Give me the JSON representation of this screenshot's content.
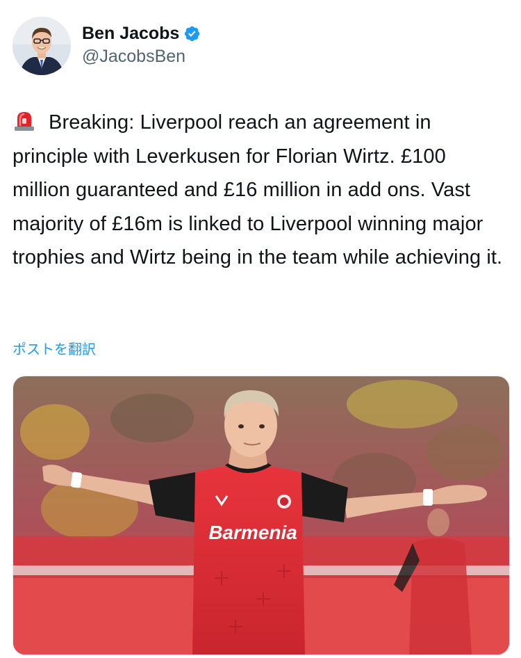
{
  "author": {
    "display_name": "Ben Jacobs",
    "handle": "@JacobsBen",
    "avatar_icon": "profile-photo-avatar",
    "verified_icon": "verified-badge-icon",
    "verified_color": "#1d9bf0"
  },
  "tweet": {
    "emoji_icon": "police-siren-icon",
    "text": "Breaking: Liverpool reach an agreement in principle with Leverkusen for Florian Wirtz. £100 million guaranteed and £16 million in add ons. Vast majority of £16m is linked to Liverpool winning major trophies and Wirtz being in the team while achieving it.",
    "translate_label": "ポストを翻訳"
  },
  "media": {
    "type": "photo",
    "shirt_sponsor": "Barmenia"
  },
  "colors": {
    "text_primary": "#0f1419",
    "text_secondary": "#536471",
    "link": "#1d9bf0"
  }
}
